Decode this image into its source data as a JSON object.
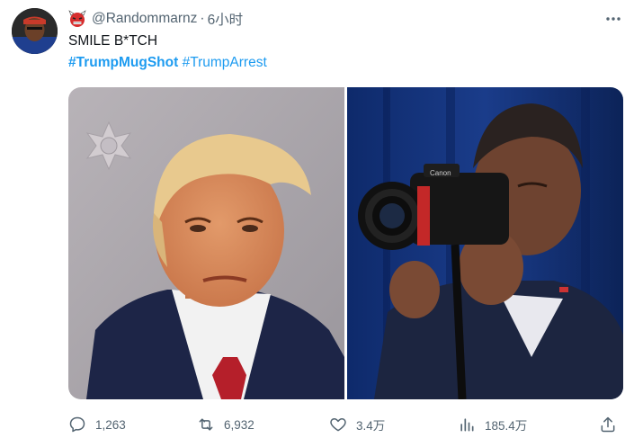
{
  "tweet": {
    "username": "@Randommarnz",
    "separator": "·",
    "time": "6小时",
    "name_emoji_icon": "ogre-mask-icon",
    "text": "SMILE B*TCH",
    "hashtags": [
      {
        "label": "#TrumpMugShot",
        "bold": true
      },
      {
        "label": "#TrumpArrest",
        "bold": false
      }
    ]
  },
  "media": {
    "left_icon": "mugshot-photo",
    "right_icon": "photographer-with-camera-photo"
  },
  "actions": {
    "replies": "1,263",
    "retweets": "6,932",
    "likes": "3.4万",
    "views": "185.4万"
  },
  "colors": {
    "accent": "#1d9bf0",
    "secondary_text": "#536471",
    "primary_text": "#0f1419"
  }
}
